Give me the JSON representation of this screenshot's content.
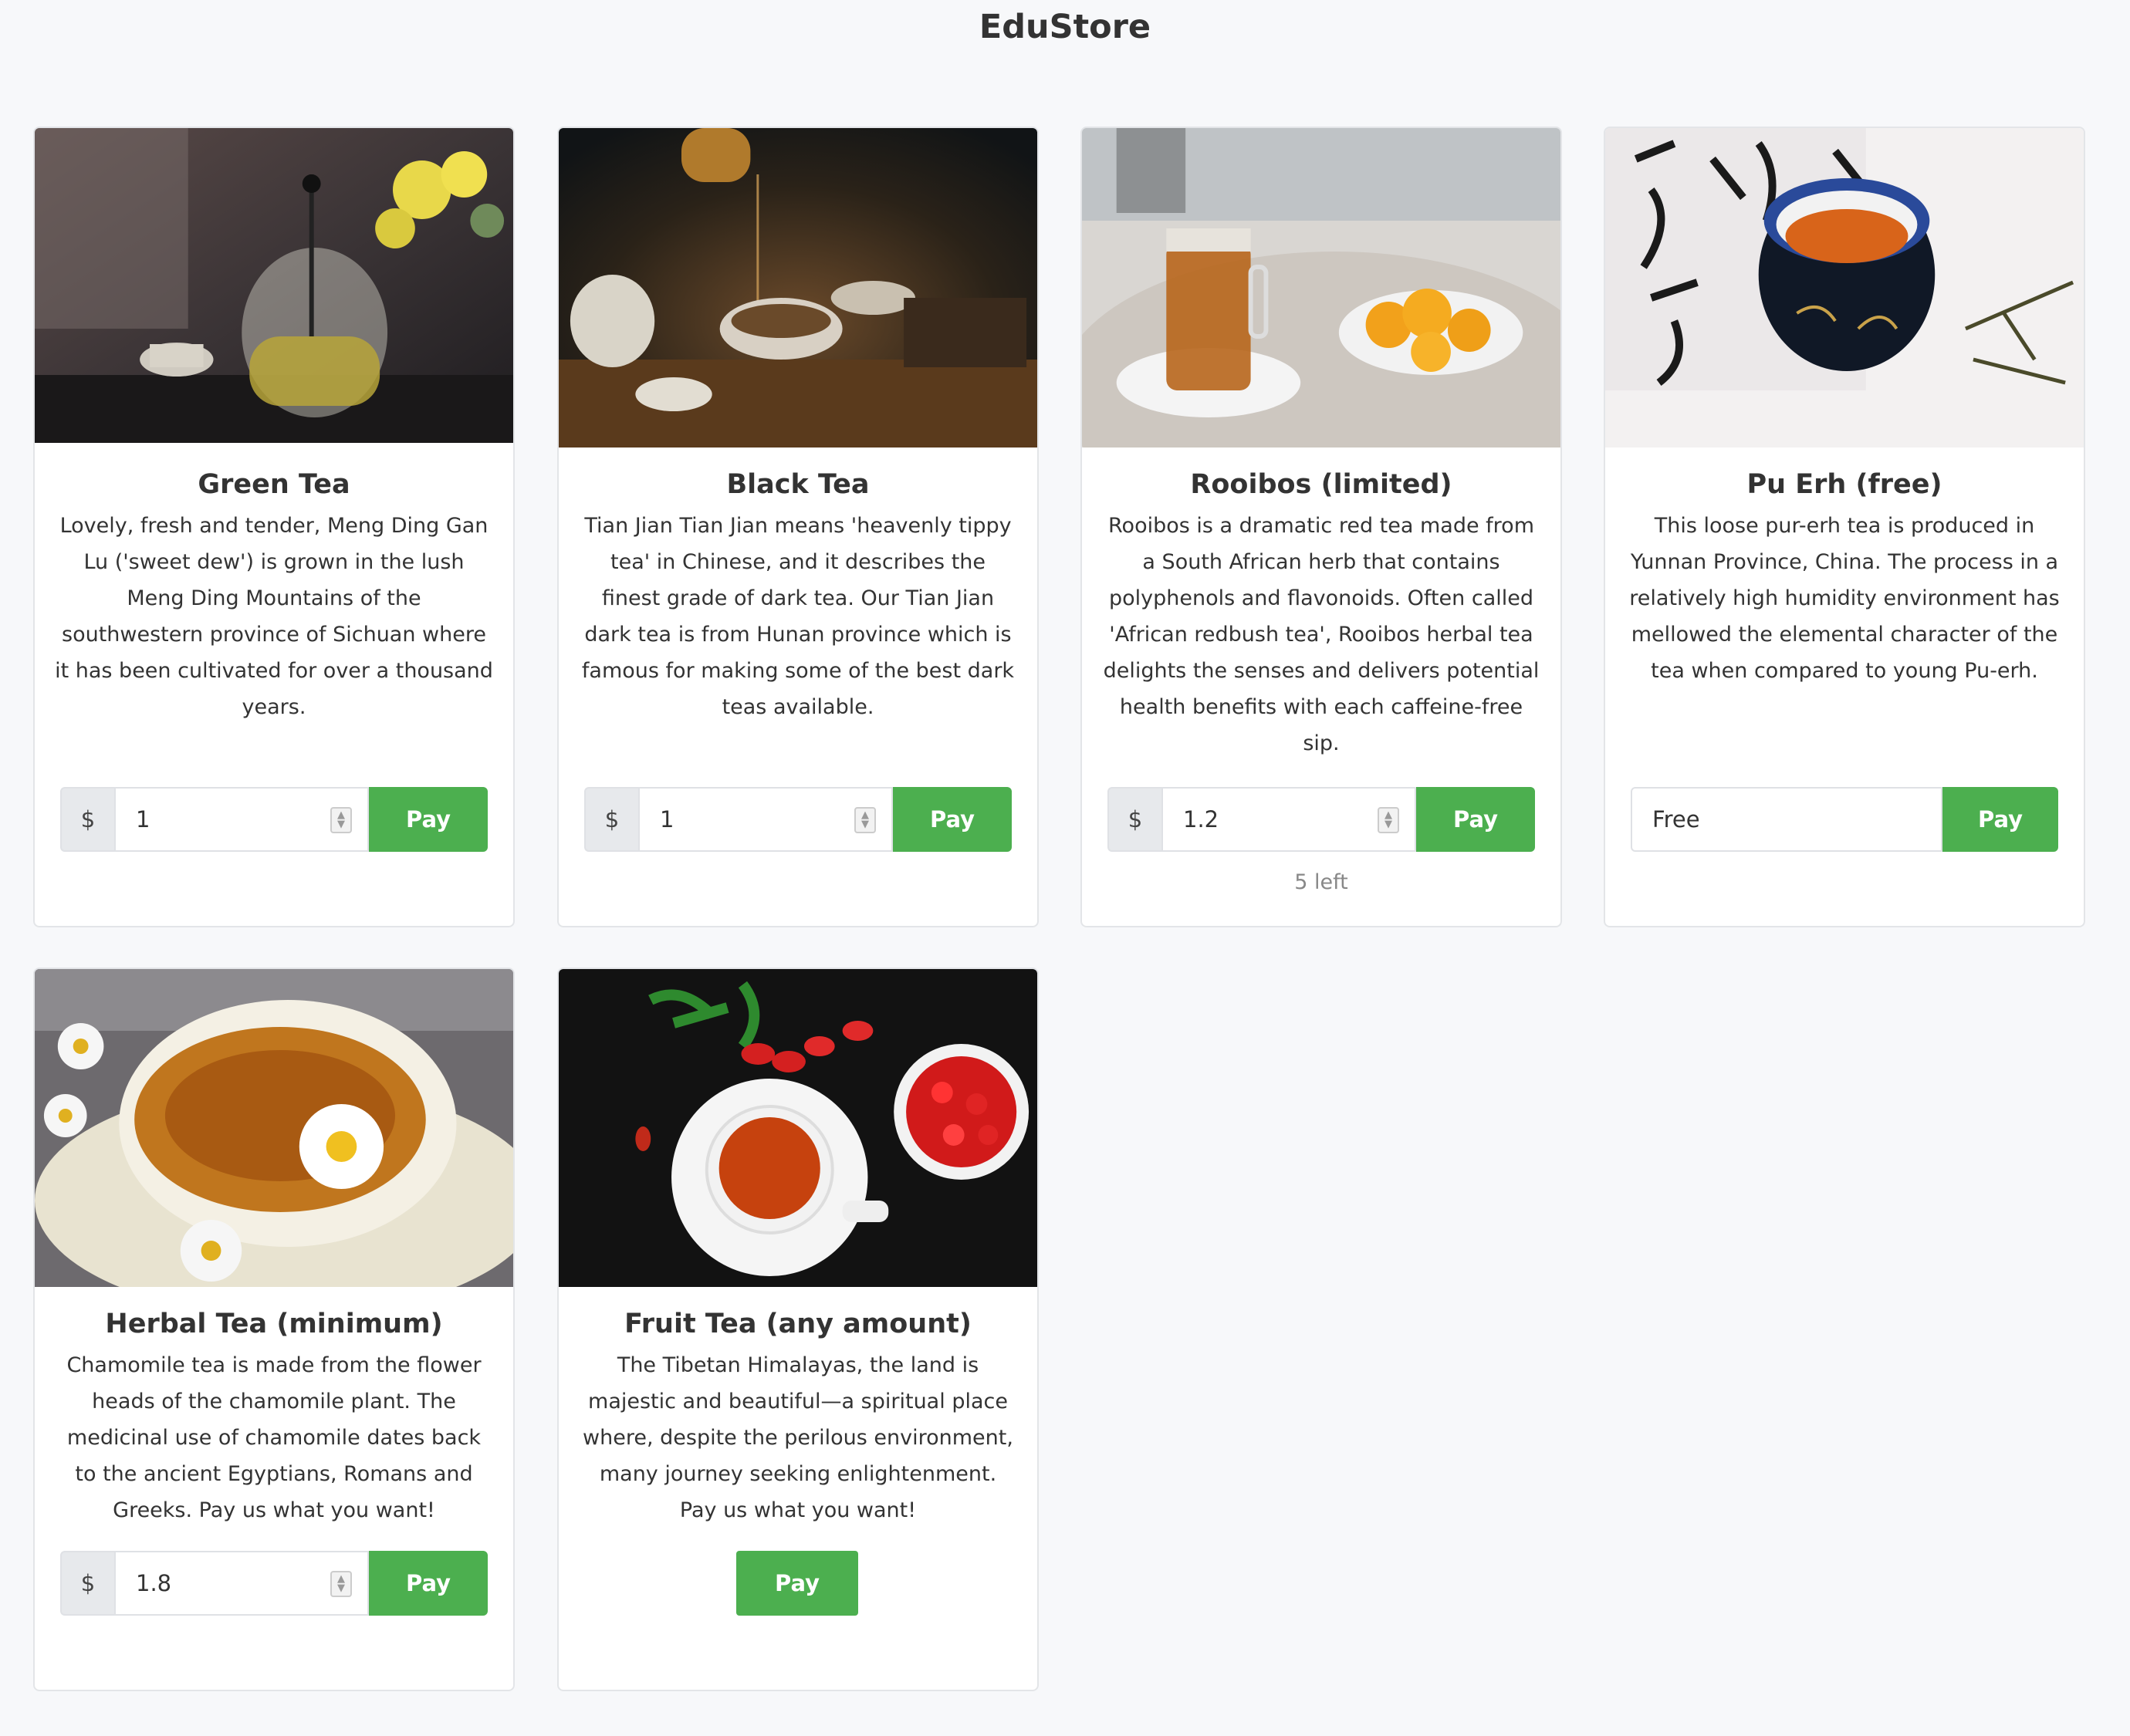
{
  "store": {
    "title": "EduStore"
  },
  "products": [
    {
      "name": "Green Tea",
      "description": "Lovely, fresh and tender, Meng Ding Gan Lu ('sweet dew') is grown in the lush Meng Ding Mountains of the southwestern province of Sichuan where it has been cultivated for over a thousand years.",
      "currency": "$",
      "amount": "1",
      "pay_label": "Pay",
      "image_icon": "tea-pot-photo"
    },
    {
      "name": "Black Tea",
      "description": "Tian Jian Tian Jian means 'heavenly tippy tea' in Chinese, and it describes the finest grade of dark tea. Our Tian Jian dark tea is from Hunan province which is famous for making some of the best dark teas available.",
      "currency": "$",
      "amount": "1",
      "pay_label": "Pay",
      "image_icon": "tea-ceremony-photo"
    },
    {
      "name": "Rooibos (limited)",
      "description": "Rooibos is a dramatic red tea made from a South African herb that contains polyphenols and flavonoids. Often called 'African redbush tea', Rooibos herbal tea delights the senses and delivers potential health benefits with each caffeine-free sip.",
      "currency": "$",
      "amount": "1.2",
      "pay_label": "Pay",
      "stock_text": "5 left",
      "image_icon": "iced-tea-jar-photo"
    },
    {
      "name": "Pu Erh (free)",
      "description": "This loose pur-erh tea is produced in Yunnan Province, China. The process in a relatively high humidity environment has mellowed the elemental character of the tea when compared to young Pu-erh.",
      "amount": "Free",
      "pay_label": "Pay",
      "image_icon": "tea-cup-calligraphy-photo"
    },
    {
      "name": "Herbal Tea (minimum)",
      "description": "Chamomile tea is made from the flower heads of the chamomile plant. The medicinal use of chamomile dates back to the ancient Egyptians, Romans and Greeks. Pay us what you want!",
      "currency": "$",
      "amount": "1.8",
      "pay_label": "Pay",
      "image_icon": "chamomile-cup-photo"
    },
    {
      "name": "Fruit Tea (any amount)",
      "description": "The Tibetan Himalayas, the land is majestic and beautiful—a spiritual place where, despite the perilous environment, many journey seeking enlightenment. Pay us what you want!",
      "pay_label": "Pay",
      "image_icon": "rosehip-tea-photo"
    }
  ],
  "colors": {
    "pay_button": "#4caf4f",
    "background": "#f7f8fa",
    "card_border": "#e3e5e8"
  }
}
